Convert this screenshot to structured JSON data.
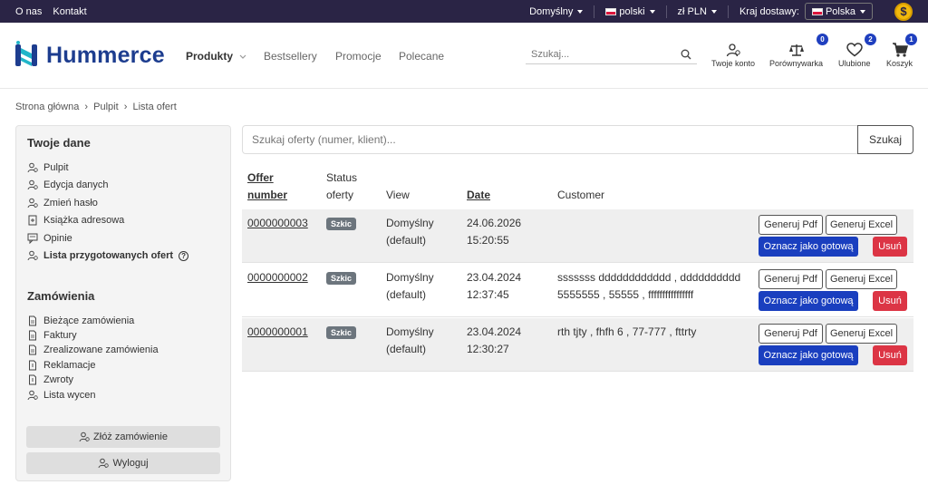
{
  "topbar": {
    "links": [
      "O nas",
      "Kontakt"
    ],
    "view_select": "Domyślny",
    "language_select": "polski",
    "currency_select": "zł PLN",
    "delivery_label": "Kraj dostawy:",
    "delivery_country": "Polska",
    "coin_symbol": "$"
  },
  "header": {
    "logo_text": "Hummerce",
    "nav": [
      "Produkty",
      "Bestsellery",
      "Promocje",
      "Polecane"
    ],
    "search_placeholder": "Szukaj...",
    "icons": [
      {
        "label": "Twoje konto",
        "icon": "user-icon"
      },
      {
        "label": "Porównywarka",
        "icon": "scales-icon",
        "badge": "0"
      },
      {
        "label": "Ulubione",
        "icon": "heart-icon",
        "badge": "2"
      },
      {
        "label": "Koszyk",
        "icon": "cart-icon",
        "badge": "1"
      }
    ]
  },
  "breadcrumb": [
    "Strona główna",
    "Pulpit",
    "Lista ofert"
  ],
  "sidebar": {
    "section1_title": "Twoje dane",
    "section1_items": [
      "Pulpit",
      "Edycja danych",
      "Zmień hasło",
      "Książka adresowa",
      "Opinie",
      "Lista przygotowanych ofert"
    ],
    "section2_title": "Zamówienia",
    "section2_items": [
      "Bieżące zamówienia",
      "Faktury",
      "Zrealizowane zamówienia",
      "Reklamacje",
      "Zwroty",
      "Lista wycen"
    ],
    "order_button": "Złóż zamówienie",
    "logout_button": "Wyloguj"
  },
  "offers": {
    "search_placeholder": "Szukaj oferty (numer, klient)...",
    "search_button": "Szukaj",
    "headers": {
      "number_line1": "Offer",
      "number_line2": "number",
      "status_line1": "Status",
      "status_line2": "oferty",
      "view": "View",
      "date": "Date",
      "customer": "Customer"
    },
    "rows": [
      {
        "number": "0000000003",
        "status": "Szkic",
        "view_line1": "Domyślny",
        "view_line2": "(default)",
        "date": "24.06.2026",
        "time": "15:20:55",
        "customer_line1": "",
        "customer_line2": ""
      },
      {
        "number": "0000000002",
        "status": "Szkic",
        "view_line1": "Domyślny",
        "view_line2": "(default)",
        "date": "23.04.2024",
        "time": "12:37:45",
        "customer_line1": "sssssss dddddddddddd , dddddddddd",
        "customer_line2": "5555555 , 55555 , ffffffffffffffff"
      },
      {
        "number": "0000000001",
        "status": "Szkic",
        "view_line1": "Domyślny",
        "view_line2": "(default)",
        "date": "23.04.2024",
        "time": "12:30:27",
        "customer_line1": "rth tjty , fhfh 6 , 77-777 , fttrty",
        "customer_line2": ""
      }
    ],
    "actions": {
      "pdf": "Generuj Pdf",
      "excel": "Generuj Excel",
      "ready": "Oznacz jako gotową",
      "delete": "Usuń"
    }
  }
}
